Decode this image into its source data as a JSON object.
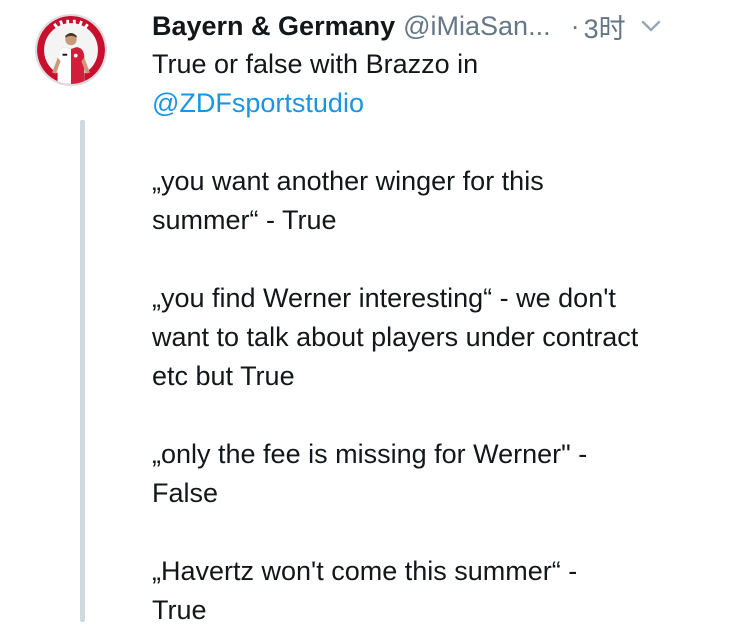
{
  "tweet": {
    "display_name": "Bayern & Germany",
    "handle": "@iMiaSan...",
    "separator": "·",
    "time": "3时",
    "avatar_icon": "profile-photo-footballer",
    "avatar_lettering": "MIA SAN MIA",
    "chevron_icon": "chevron-down-icon",
    "text": {
      "intro_line1": "True or false with Brazzo in",
      "mention": "@ZDFsportstudio",
      "q1_line1": "„you want another winger for this",
      "q1_line2": "summer“ - True",
      "q2_line1": "„you find Werner interesting“ - we don't",
      "q2_line2": "want to talk about players under contract",
      "q2_line3": "etc but True",
      "q3_line1": "„only the fee is missing for Werner\" -",
      "q3_line2": "False",
      "q4_line1": "„Havertz won't come this summer“ -",
      "q4_line2": "True"
    }
  },
  "colors": {
    "text": "#14171a",
    "muted": "#657786",
    "link": "#1b95e0",
    "thread_line": "#cfd9de",
    "avatar_ring": "#c8102e"
  }
}
